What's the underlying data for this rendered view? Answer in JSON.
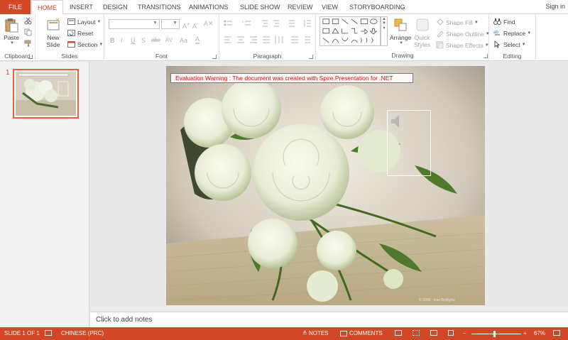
{
  "tabs": {
    "file": "FILE",
    "items": [
      "HOME",
      "INSERT",
      "DESIGN",
      "TRANSITIONS",
      "ANIMATIONS",
      "SLIDE SHOW",
      "REVIEW",
      "VIEW",
      "STORYBOARDING"
    ],
    "active": "HOME",
    "sign_in": "Sign in"
  },
  "ribbon": {
    "clipboard": {
      "label": "Clipboard",
      "paste": "Paste"
    },
    "slides": {
      "label": "Slides",
      "new_slide_1": "New",
      "new_slide_2": "Slide",
      "layout": "Layout",
      "reset": "Reset",
      "section": "Section"
    },
    "font": {
      "label": "Font",
      "bold": "B",
      "italic": "I",
      "underline": "U",
      "shadow": "S",
      "strike": "abc",
      "spacing": "AV",
      "case": "Aa",
      "color": "A"
    },
    "paragraph": {
      "label": "Paragraph"
    },
    "drawing": {
      "label": "Drawing",
      "arrange": "Arrange",
      "quick_1": "Quick",
      "quick_2": "Styles",
      "shape_fill": "Shape Fill",
      "shape_outline": "Shape Outline",
      "shape_effects": "Shape Effects"
    },
    "editing": {
      "label": "Editing",
      "find": "Find",
      "replace": "Replace",
      "select": "Select"
    }
  },
  "thumbnails": {
    "slide_number": "1"
  },
  "slide": {
    "warning": "Evaluation Warning : The document was created with Spire.Presentation for .NET",
    "watermark": "© 2008 · Ivan Boldyrev"
  },
  "notes": {
    "placeholder": "Click to add notes"
  },
  "status": {
    "slide": "SLIDE 1 OF 1",
    "language": "CHINESE (PRC)",
    "notes": "NOTES",
    "comments": "COMMENTS",
    "zoom_minus": "−",
    "zoom_plus": "+",
    "zoom": "67%",
    "zoom_level": 0.45
  },
  "colors": {
    "accent": "#d24726",
    "thumb_border": "#e8603c",
    "warning_text": "#ee0000"
  }
}
